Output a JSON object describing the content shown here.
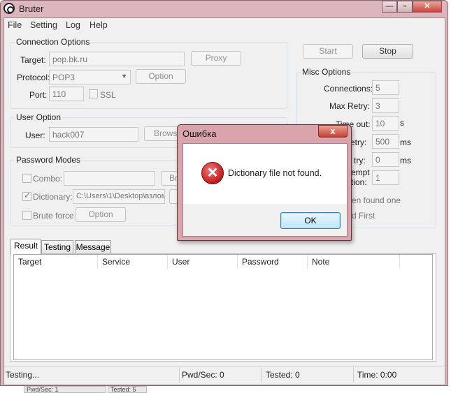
{
  "window": {
    "title": "Bruter"
  },
  "menu": [
    "File",
    "Setting",
    "Log",
    "Help"
  ],
  "connection": {
    "group_title": "Connection Options",
    "target_label": "Target:",
    "target_value": "pop.bk.ru",
    "proxy_button": "Proxy",
    "protocol_label": "Protocol:",
    "protocol_value": "POP3",
    "option_button": "Option",
    "port_label": "Port:",
    "port_value": "110",
    "ssl_label": "SSL"
  },
  "user": {
    "group_title": "User Option",
    "user_label": "User:",
    "user_value": "hack007",
    "browse_button": "Browse"
  },
  "password": {
    "group_title": "Password Modes",
    "combo_label": "Combo:",
    "combo_button": "Br",
    "dictionary_label": "Dictionary:",
    "dictionary_value": "C:\\Users\\1\\Desktop\\взлом",
    "brute_label": "Brute force",
    "brute_option": "Option"
  },
  "controls": {
    "start": "Start",
    "stop": "Stop"
  },
  "misc": {
    "group_title": "Misc Options",
    "connections_label": "Connections:",
    "connections_value": "5",
    "maxretry_label": "Max Retry:",
    "maxretry_value": "3",
    "timeout_label": "Time out:",
    "timeout_value": "10",
    "timeout_unit": "s",
    "retry_delay_label": "etry:",
    "retry_delay_value": "500",
    "retry_delay_unit": "ms",
    "delay_label": "try:",
    "delay_value": "0",
    "delay_unit": "ms",
    "attempt_label_1": "empt",
    "attempt_label_2": "tion:",
    "attempt_value": "1",
    "found_one_label": "en found one",
    "first_label": "d First"
  },
  "tabs": [
    "Result",
    "Testing",
    "Message"
  ],
  "table": {
    "columns": [
      "Target",
      "Service",
      "User",
      "Password",
      "Note"
    ]
  },
  "status": {
    "state": "Testing...",
    "pwd_sec": "Pwd/Sec: 0",
    "tested": "Tested: 0",
    "time": "Time: 0:00"
  },
  "dialog": {
    "title": "Ошибка",
    "close": "x",
    "message": "Dictionary file not found.",
    "ok": "OK"
  },
  "background_window": {
    "left_text": "Pwd/Sec: 1",
    "right_text": "Tested: 5"
  }
}
